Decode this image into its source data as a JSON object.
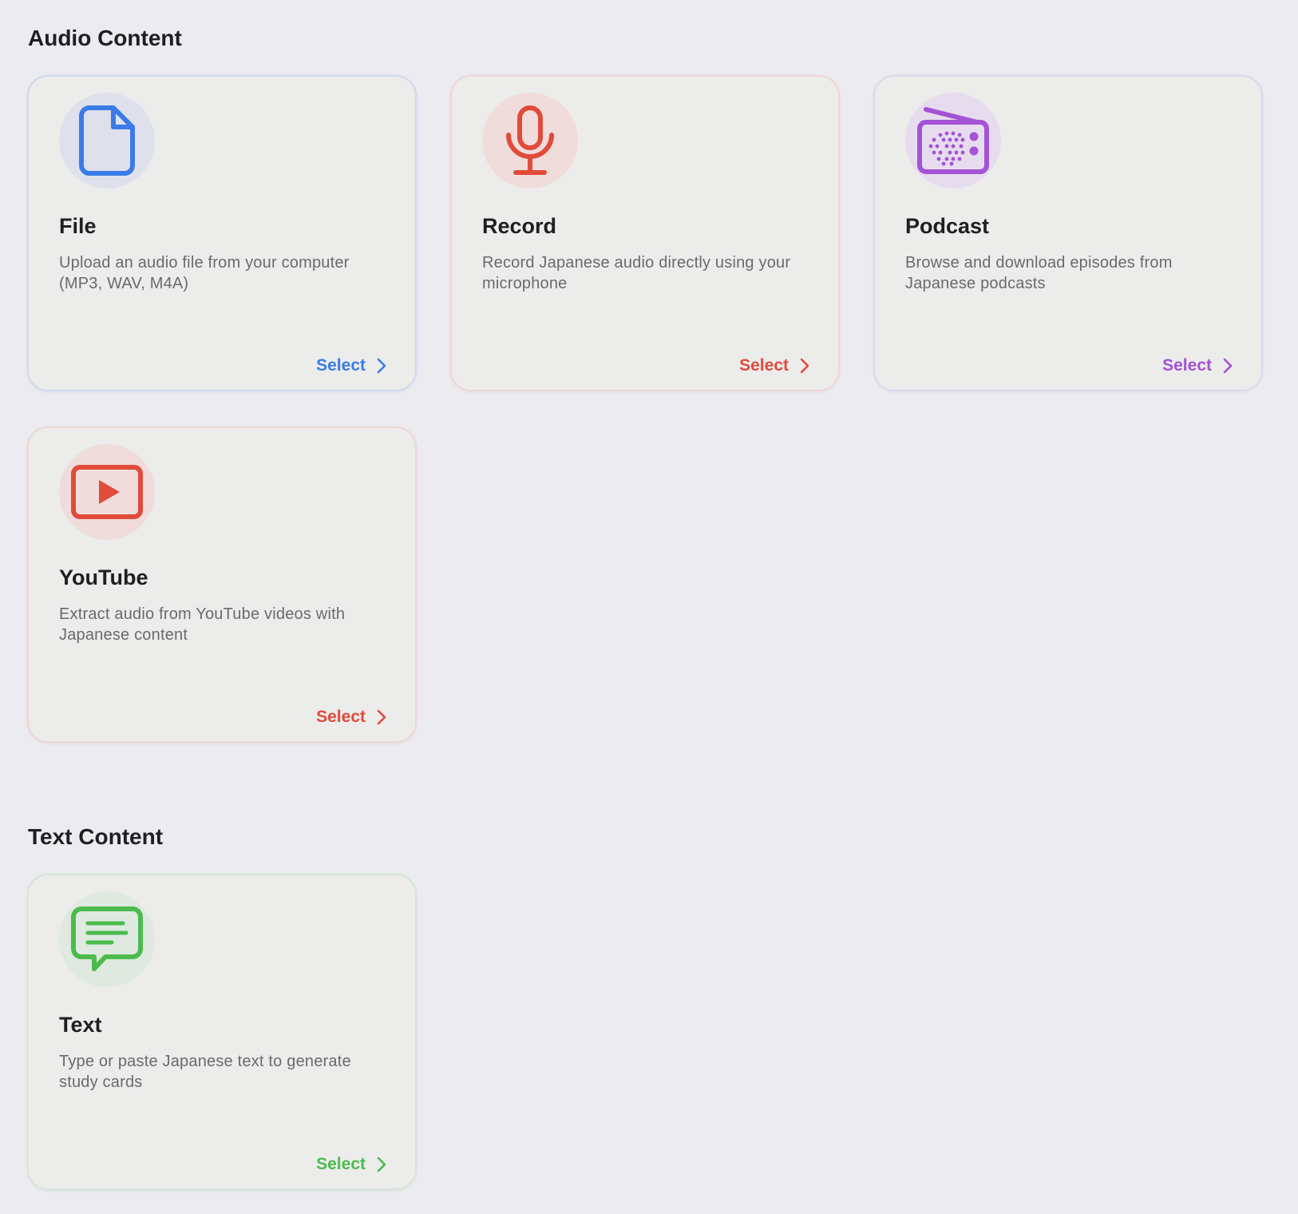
{
  "sections": {
    "audio": {
      "title": "Audio Content",
      "cards": [
        {
          "icon": "file-icon",
          "title": "File",
          "description": "Upload an audio file from your computer (MP3, WAV, M4A)",
          "action": "Select",
          "color": "#3a7be8"
        },
        {
          "icon": "microphone-icon",
          "title": "Record",
          "description": "Record Japanese audio directly using your microphone",
          "action": "Select",
          "color": "#e04b3a"
        },
        {
          "icon": "radio-icon",
          "title": "Podcast",
          "description": "Browse and download episodes from Japanese podcasts",
          "action": "Select",
          "color": "#a452d6"
        },
        {
          "icon": "youtube-play-icon",
          "title": "YouTube",
          "description": "Extract audio from YouTube videos with Japanese content",
          "action": "Select",
          "color": "#e04b3a"
        }
      ]
    },
    "text": {
      "title": "Text Content",
      "cards": [
        {
          "icon": "chat-bubble-icon",
          "title": "Text",
          "description": "Type or paste Japanese text to generate study cards",
          "action": "Select",
          "color": "#4cbb4f"
        }
      ]
    }
  }
}
